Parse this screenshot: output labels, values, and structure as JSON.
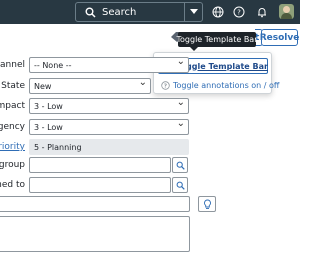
{
  "header": {
    "search_placeholder": "Search",
    "icons": [
      "search-icon",
      "chevron-down-icon",
      "globe-icon",
      "help-icon",
      "bell-icon"
    ]
  },
  "toolbar": {
    "resolve_label": "Resolve",
    "partial_button_label": "t"
  },
  "tooltip": {
    "text": "Toggle Template Bar"
  },
  "menu": {
    "items": [
      {
        "icon": "template-bar-icon",
        "glyph": "99",
        "label": "Toggle Template Bar"
      },
      {
        "icon": "help-circle-icon",
        "glyph": "?",
        "label": "Toggle annotations on / off"
      }
    ]
  },
  "form": {
    "channel": {
      "label": "Channel",
      "value": "-- None --"
    },
    "state": {
      "label": "State",
      "value": "New"
    },
    "impact": {
      "label": "Impact",
      "value": "3 - Low"
    },
    "urgency": {
      "label": "Urgency",
      "value": "3 - Low"
    },
    "priority": {
      "label": "Priority",
      "value": "5 - Planning"
    },
    "assignment_group": {
      "label": "t group",
      "value": ""
    },
    "assigned_to": {
      "label": "gned to",
      "value": ""
    }
  },
  "colors": {
    "header_bg": "#283842",
    "accent": "#2f6db5"
  }
}
